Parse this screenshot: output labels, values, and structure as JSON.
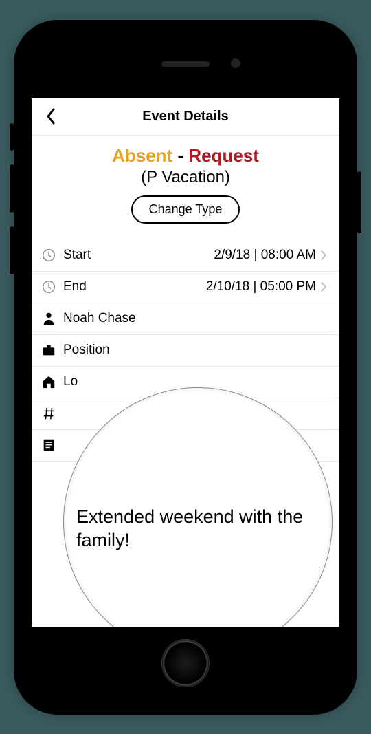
{
  "nav": {
    "title": "Event Details"
  },
  "event": {
    "status_a": "Absent",
    "sep": " - ",
    "status_b": "Request",
    "subtype": "(P Vacation)",
    "change_btn": "Change Type",
    "start_label": "Start",
    "start_value": "2/9/18 | 08:00 AM",
    "end_label": "End",
    "end_value": "2/10/18 | 05:00 PM",
    "person": "Noah Chase",
    "position_label": "Position",
    "location_label": "Lo",
    "note": "Extended weekend with the family!"
  }
}
